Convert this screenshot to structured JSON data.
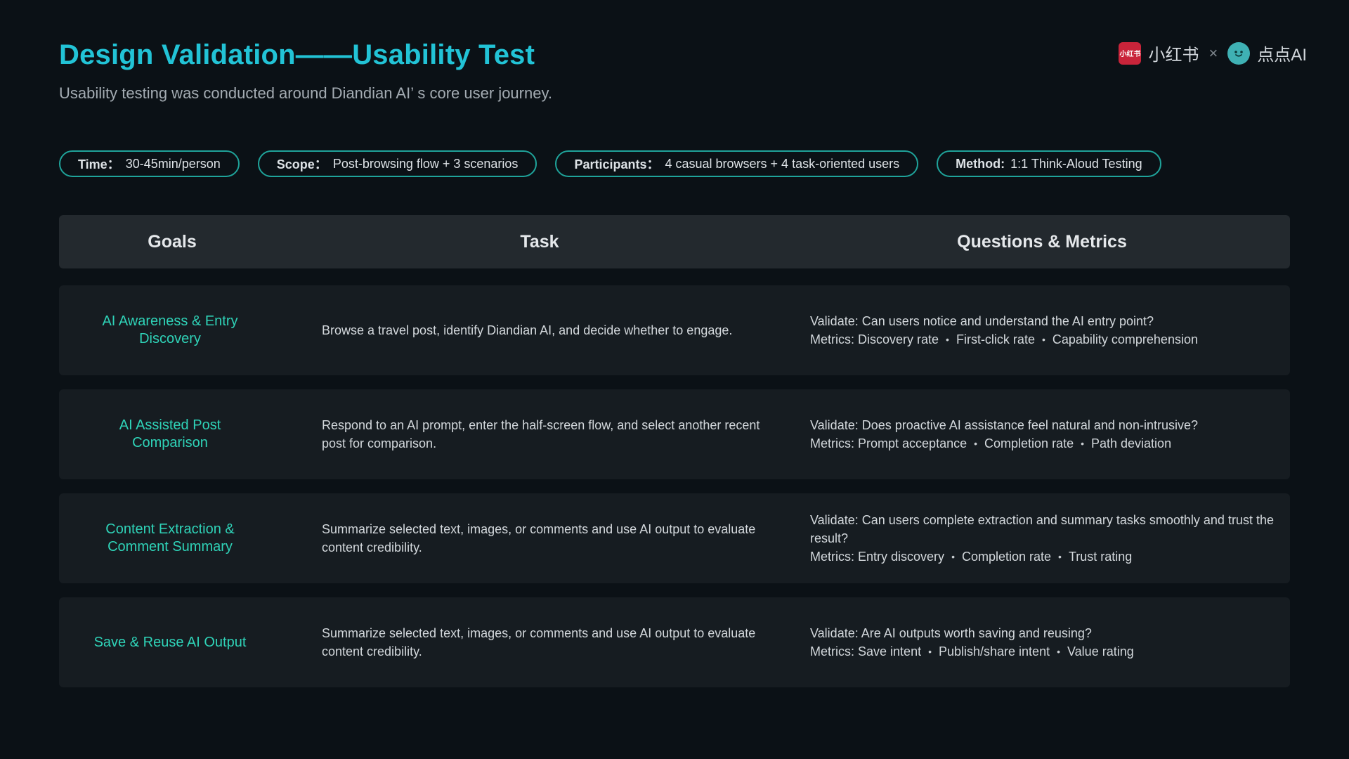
{
  "header": {
    "title": "Design Validation——Usability Test",
    "subtitle": "Usability testing was conducted around Diandian AI’ s core user journey."
  },
  "brand": {
    "xhs_logo_text": "小红书",
    "xhs_name": "小红书",
    "separator": "×",
    "dd_name": "点点AI"
  },
  "pills": [
    {
      "label": "Time：",
      "value": "30-45min/person"
    },
    {
      "label": "Scope：",
      "value": "Post-browsing flow + 3 scenarios"
    },
    {
      "label": "Participants：",
      "value": "4 casual browsers + 4 task-oriented users"
    },
    {
      "label": "Method:",
      "value": "1:1 Think-Aloud Testing"
    }
  ],
  "table": {
    "headers": {
      "goals": "Goals",
      "task": "Task",
      "questions": "Questions & Metrics"
    },
    "rows": [
      {
        "goal": "AI Awareness & Entry Discovery",
        "task": "Browse a travel post, identify Diandian AI, and decide whether to engage.",
        "validate": "Validate: Can users notice and understand the AI entry point?",
        "metrics_label": "Metrics:",
        "metrics": [
          "Discovery rate",
          "First-click rate",
          "Capability comprehension"
        ]
      },
      {
        "goal": "AI Assisted Post Comparison",
        "task": "Respond to an AI prompt, enter the half-screen flow, and select another recent post for comparison.",
        "validate": "Validate: Does proactive AI assistance feel natural and non-intrusive?",
        "metrics_label": "Metrics:",
        "metrics": [
          "Prompt acceptance",
          "Completion rate",
          "Path deviation"
        ]
      },
      {
        "goal": "Content Extraction & Comment Summary",
        "task": "Summarize selected text, images, or comments and use AI output to evaluate content credibility.",
        "validate": "Validate: Can users complete extraction and summary tasks smoothly and trust the result?",
        "metrics_label": "Metrics:",
        "metrics": [
          "Entry discovery",
          "Completion rate",
          "Trust rating"
        ]
      },
      {
        "goal": "Save & Reuse AI Output",
        "task": "Summarize selected text, images, or comments and use AI output to evaluate content credibility.",
        "validate": "Validate: Are AI outputs worth saving and reusing?",
        "metrics_label": "Metrics:",
        "metrics": [
          "Save intent",
          "Publish/share intent",
          "Value rating"
        ]
      }
    ]
  },
  "colors": {
    "background": "#0b1116",
    "title": "#22c3d6",
    "goal_text": "#2fd3b8",
    "pill_border": "#1fa39a",
    "row_bg": "#161c21",
    "header_bg": "#23292e"
  }
}
